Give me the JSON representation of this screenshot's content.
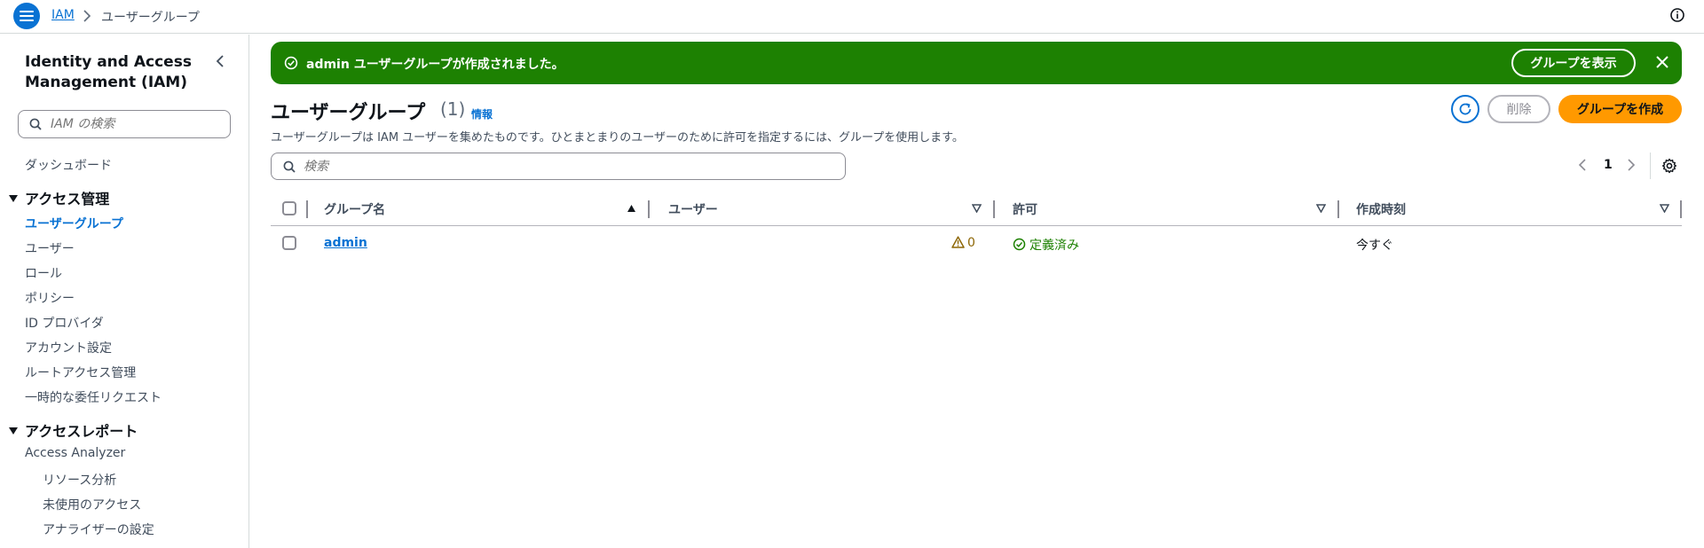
{
  "topbar": {
    "breadcrumb_root": "IAM",
    "breadcrumb_current": "ユーザーグループ"
  },
  "sidebar": {
    "title": "Identity and Access Management (IAM)",
    "search_placeholder": "IAM の検索",
    "dashboard": "ダッシュボード",
    "access_management": {
      "label": "アクセス管理",
      "items": [
        "ユーザーグループ",
        "ユーザー",
        "ロール",
        "ポリシー",
        "ID プロバイダ",
        "アカウント設定",
        "ルートアクセス管理",
        "一時的な委任リクエスト"
      ]
    },
    "access_reports": {
      "label": "アクセスレポート",
      "items": [
        "Access Analyzer"
      ],
      "sub_items": [
        "リソース分析",
        "未使用のアクセス",
        "アナライザーの設定"
      ]
    }
  },
  "flash": {
    "message": "admin ユーザーグループが作成されました。",
    "view_button": "グループを表示"
  },
  "header": {
    "title": "ユーザーグループ",
    "count": "(1)",
    "info": "情報",
    "description": "ユーザーグループは IAM ユーザーを集めたものです。ひとまとまりのユーザーのために許可を指定するには、グループを使用します。",
    "delete_button": "削除",
    "create_button": "グループを作成"
  },
  "filter": {
    "placeholder": "検索"
  },
  "pagination": {
    "current": "1"
  },
  "table": {
    "columns": [
      "グループ名",
      "ユーザー",
      "許可",
      "作成時刻"
    ],
    "rows": [
      {
        "name": "admin",
        "users": "0",
        "permissions": "定義済み",
        "created": "今すぐ"
      }
    ]
  },
  "colors": {
    "accent": "#0972d3",
    "success": "#1d8102",
    "primary_button": "#ff9900",
    "warning": "#8d6605"
  }
}
